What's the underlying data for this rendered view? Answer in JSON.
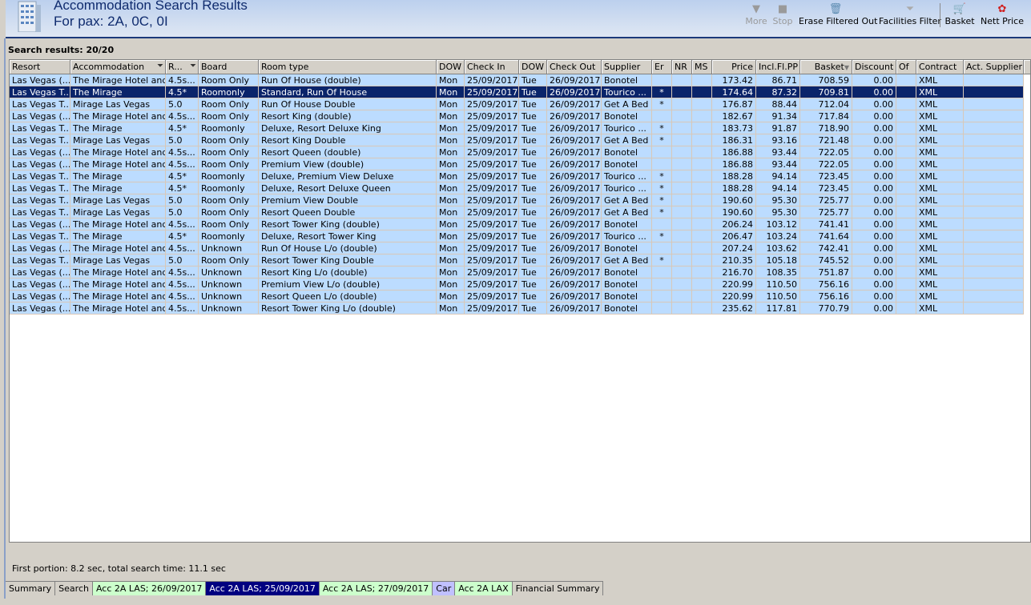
{
  "header": {
    "title": "Accommodation Search Results",
    "subtitle": "For pax: 2A, 0C, 0I"
  },
  "toolbar": [
    {
      "label": "More",
      "icon": "triangle-down-icon",
      "enabled": false
    },
    {
      "label": "Stop",
      "icon": "stop-icon",
      "enabled": false
    },
    {
      "label": "Erase Filtered Out",
      "icon": "erase-bin-icon",
      "enabled": true
    },
    {
      "label": "Facilities Filter",
      "icon": "funnel-icon",
      "enabled": true
    },
    {
      "label": "Basket",
      "icon": "basket-cart-icon",
      "enabled": true
    },
    {
      "label": "Nett Price",
      "icon": "nett-price-icon",
      "enabled": true
    }
  ],
  "results_label": "Search results: 20/20",
  "columns": [
    "Resort",
    "Accommodation",
    "R...",
    "Board",
    "Room type",
    "DOW",
    "Check In",
    "DOW",
    "Check Out",
    "Supplier",
    "Er",
    "NR",
    "MS",
    "Price",
    "Incl.Fl.PP",
    "Basket",
    "Discount",
    "Of",
    "Contract",
    "Act. Supplier"
  ],
  "selected_row": 1,
  "rows": [
    [
      "Las Vegas (...",
      "The Mirage Hotel and...",
      "4.5s...",
      "Room Only",
      "Run Of House (double)",
      "Mon",
      "25/09/2017",
      "Tue",
      "26/09/2017",
      "Bonotel",
      "",
      "",
      "",
      "173.42",
      "86.71",
      "708.59",
      "0.00",
      "",
      "XML",
      ""
    ],
    [
      "Las Vegas T...",
      "The Mirage",
      "4.5*",
      "Roomonly",
      "Standard, Run Of House",
      "Mon",
      "25/09/2017",
      "Tue",
      "26/09/2017",
      "Tourico ...",
      "*",
      "",
      "",
      "174.64",
      "87.32",
      "709.81",
      "0.00",
      "",
      "XML",
      ""
    ],
    [
      "Las Vegas T...",
      "Mirage Las Vegas",
      "5.0",
      "Room Only",
      "Run Of House Double",
      "Mon",
      "25/09/2017",
      "Tue",
      "26/09/2017",
      "Get A Bed",
      "*",
      "",
      "",
      "176.87",
      "88.44",
      "712.04",
      "0.00",
      "",
      "XML",
      ""
    ],
    [
      "Las Vegas (...",
      "The Mirage Hotel and...",
      "4.5s...",
      "Room Only",
      "Resort King (double)",
      "Mon",
      "25/09/2017",
      "Tue",
      "26/09/2017",
      "Bonotel",
      "",
      "",
      "",
      "182.67",
      "91.34",
      "717.84",
      "0.00",
      "",
      "XML",
      ""
    ],
    [
      "Las Vegas T...",
      "The Mirage",
      "4.5*",
      "Roomonly",
      "Deluxe, Resort Deluxe King",
      "Mon",
      "25/09/2017",
      "Tue",
      "26/09/2017",
      "Tourico ...",
      "*",
      "",
      "",
      "183.73",
      "91.87",
      "718.90",
      "0.00",
      "",
      "XML",
      ""
    ],
    [
      "Las Vegas T...",
      "Mirage Las Vegas",
      "5.0",
      "Room Only",
      "Resort King Double",
      "Mon",
      "25/09/2017",
      "Tue",
      "26/09/2017",
      "Get A Bed",
      "*",
      "",
      "",
      "186.31",
      "93.16",
      "721.48",
      "0.00",
      "",
      "XML",
      ""
    ],
    [
      "Las Vegas (...",
      "The Mirage Hotel and...",
      "4.5s...",
      "Room Only",
      "Resort Queen (double)",
      "Mon",
      "25/09/2017",
      "Tue",
      "26/09/2017",
      "Bonotel",
      "",
      "",
      "",
      "186.88",
      "93.44",
      "722.05",
      "0.00",
      "",
      "XML",
      ""
    ],
    [
      "Las Vegas (...",
      "The Mirage Hotel and...",
      "4.5s...",
      "Room Only",
      "Premium View (double)",
      "Mon",
      "25/09/2017",
      "Tue",
      "26/09/2017",
      "Bonotel",
      "",
      "",
      "",
      "186.88",
      "93.44",
      "722.05",
      "0.00",
      "",
      "XML",
      ""
    ],
    [
      "Las Vegas T...",
      "The Mirage",
      "4.5*",
      "Roomonly",
      "Deluxe, Premium View Deluxe",
      "Mon",
      "25/09/2017",
      "Tue",
      "26/09/2017",
      "Tourico ...",
      "*",
      "",
      "",
      "188.28",
      "94.14",
      "723.45",
      "0.00",
      "",
      "XML",
      ""
    ],
    [
      "Las Vegas T...",
      "The Mirage",
      "4.5*",
      "Roomonly",
      "Deluxe, Resort Deluxe Queen",
      "Mon",
      "25/09/2017",
      "Tue",
      "26/09/2017",
      "Tourico ...",
      "*",
      "",
      "",
      "188.28",
      "94.14",
      "723.45",
      "0.00",
      "",
      "XML",
      ""
    ],
    [
      "Las Vegas T...",
      "Mirage Las Vegas",
      "5.0",
      "Room Only",
      "Premium View Double",
      "Mon",
      "25/09/2017",
      "Tue",
      "26/09/2017",
      "Get A Bed",
      "*",
      "",
      "",
      "190.60",
      "95.30",
      "725.77",
      "0.00",
      "",
      "XML",
      ""
    ],
    [
      "Las Vegas T...",
      "Mirage Las Vegas",
      "5.0",
      "Room Only",
      "Resort Queen Double",
      "Mon",
      "25/09/2017",
      "Tue",
      "26/09/2017",
      "Get A Bed",
      "*",
      "",
      "",
      "190.60",
      "95.30",
      "725.77",
      "0.00",
      "",
      "XML",
      ""
    ],
    [
      "Las Vegas (...",
      "The Mirage Hotel and...",
      "4.5s...",
      "Room Only",
      "Resort Tower King (double)",
      "Mon",
      "25/09/2017",
      "Tue",
      "26/09/2017",
      "Bonotel",
      "",
      "",
      "",
      "206.24",
      "103.12",
      "741.41",
      "0.00",
      "",
      "XML",
      ""
    ],
    [
      "Las Vegas T...",
      "The Mirage",
      "4.5*",
      "Roomonly",
      "Deluxe, Resort Tower King",
      "Mon",
      "25/09/2017",
      "Tue",
      "26/09/2017",
      "Tourico ...",
      "*",
      "",
      "",
      "206.47",
      "103.24",
      "741.64",
      "0.00",
      "",
      "XML",
      ""
    ],
    [
      "Las Vegas (...",
      "The Mirage Hotel and...",
      "4.5s...",
      "Unknown",
      "Run Of House L/o (double)",
      "Mon",
      "25/09/2017",
      "Tue",
      "26/09/2017",
      "Bonotel",
      "",
      "",
      "",
      "207.24",
      "103.62",
      "742.41",
      "0.00",
      "",
      "XML",
      ""
    ],
    [
      "Las Vegas T...",
      "Mirage Las Vegas",
      "5.0",
      "Room Only",
      "Resort Tower King Double",
      "Mon",
      "25/09/2017",
      "Tue",
      "26/09/2017",
      "Get A Bed",
      "*",
      "",
      "",
      "210.35",
      "105.18",
      "745.52",
      "0.00",
      "",
      "XML",
      ""
    ],
    [
      "Las Vegas (...",
      "The Mirage Hotel and...",
      "4.5s...",
      "Unknown",
      "Resort King L/o (double)",
      "Mon",
      "25/09/2017",
      "Tue",
      "26/09/2017",
      "Bonotel",
      "",
      "",
      "",
      "216.70",
      "108.35",
      "751.87",
      "0.00",
      "",
      "XML",
      ""
    ],
    [
      "Las Vegas (...",
      "The Mirage Hotel and...",
      "4.5s...",
      "Unknown",
      "Premium View L/o (double)",
      "Mon",
      "25/09/2017",
      "Tue",
      "26/09/2017",
      "Bonotel",
      "",
      "",
      "",
      "220.99",
      "110.50",
      "756.16",
      "0.00",
      "",
      "XML",
      ""
    ],
    [
      "Las Vegas (...",
      "The Mirage Hotel and...",
      "4.5s...",
      "Unknown",
      "Resort Queen L/o (double)",
      "Mon",
      "25/09/2017",
      "Tue",
      "26/09/2017",
      "Bonotel",
      "",
      "",
      "",
      "220.99",
      "110.50",
      "756.16",
      "0.00",
      "",
      "XML",
      ""
    ],
    [
      "Las Vegas (...",
      "The Mirage Hotel and...",
      "4.5s...",
      "Unknown",
      "Resort Tower King L/o (double)",
      "Mon",
      "25/09/2017",
      "Tue",
      "26/09/2017",
      "Bonotel",
      "",
      "",
      "",
      "235.62",
      "117.81",
      "770.79",
      "0.00",
      "",
      "XML",
      ""
    ]
  ],
  "status": "First portion: 8.2 sec, total search time: 11.1 sec",
  "tabs": [
    {
      "label": "Summary",
      "color": "#d4d0c8"
    },
    {
      "label": "Search",
      "color": "#d4d0c8"
    },
    {
      "label": "Acc 2A LAS; 26/09/2017",
      "color": "#ccffcc"
    },
    {
      "label": "Acc 2A LAS; 25/09/2017",
      "color": "#000080",
      "active": true
    },
    {
      "label": "Acc 2A LAS; 27/09/2017",
      "color": "#ccffcc"
    },
    {
      "label": "Car",
      "color": "#c0c0ff"
    },
    {
      "label": "Acc 2A LAX",
      "color": "#ccffcc"
    },
    {
      "label": "Financial Summary",
      "color": "#d4d0c8"
    }
  ]
}
